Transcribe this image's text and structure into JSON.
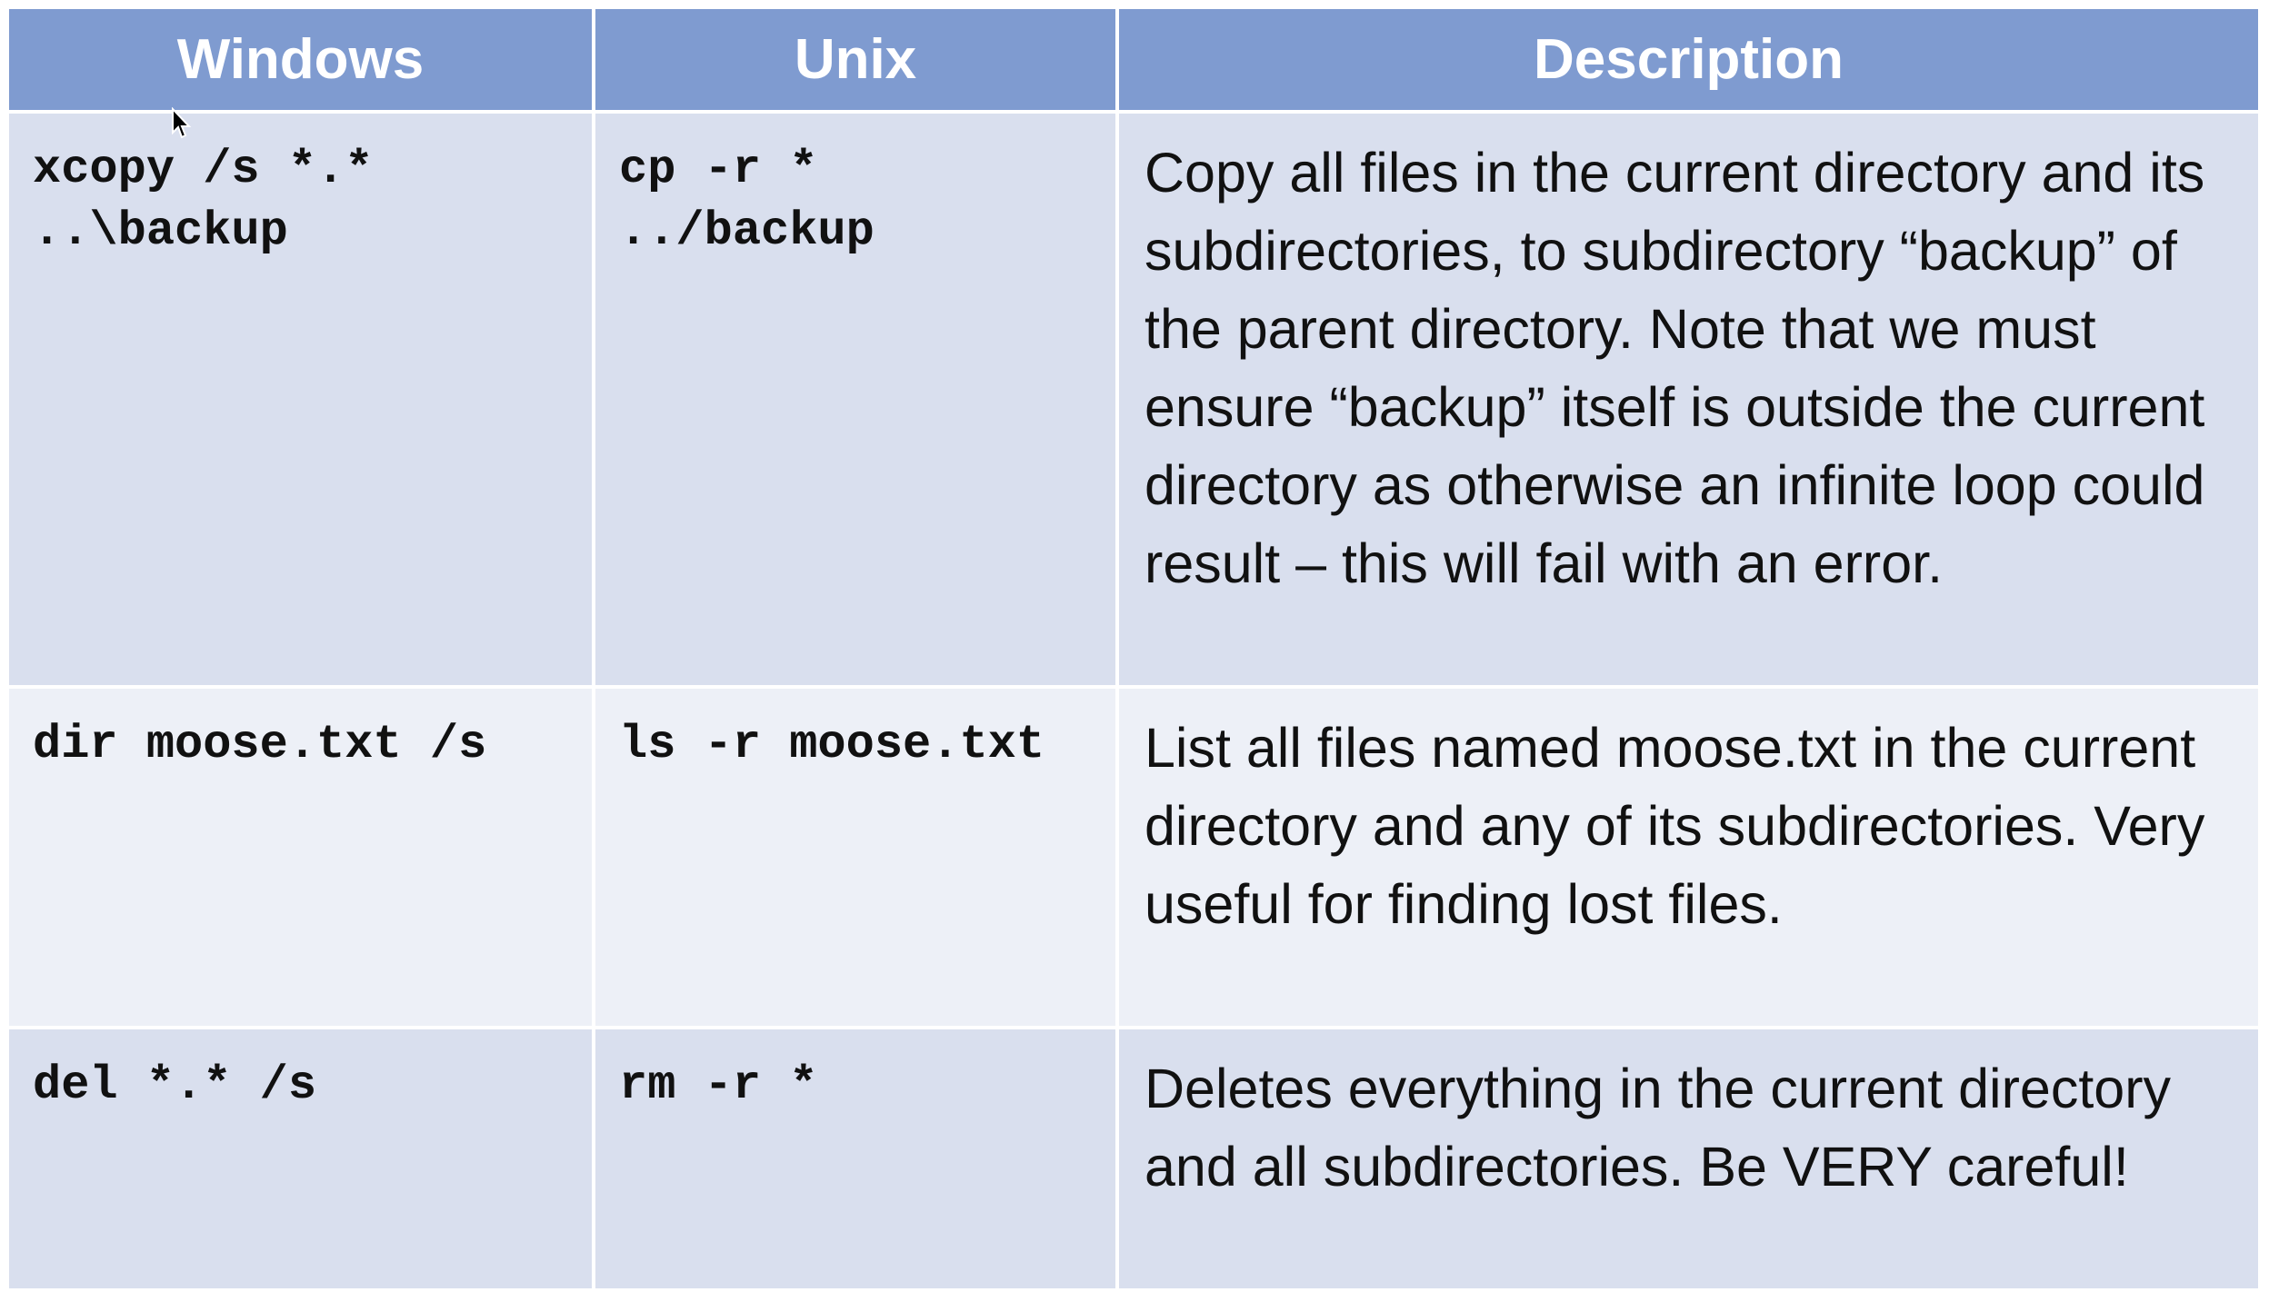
{
  "table": {
    "headers": {
      "windows": "Windows",
      "unix": "Unix",
      "description": "Description"
    },
    "rows": [
      {
        "windows": "xcopy /s *.*\n..\\backup",
        "unix": "cp -r *\n../backup",
        "description": "Copy all files in the current directory and its subdirectories, to subdirectory “backup” of the parent directory. Note that we must ensure “backup” itself is outside the current directory as otherwise an infinite loop could result – this will fail with an error."
      },
      {
        "windows": "dir moose.txt /s",
        "unix": "ls -r moose.txt",
        "description": "List all files named moose.txt in the current directory and any of its subdirectories. Very useful for finding lost files."
      },
      {
        "windows": "del *.* /s",
        "unix": "rm -r *",
        "description": "Deletes everything in the current directory and all subdirectories. Be VERY careful!"
      }
    ]
  },
  "colors": {
    "header_bg": "#7f9bd0",
    "row_odd_bg": "#d9dfee",
    "row_even_bg": "#edf0f7",
    "header_text": "#ffffff",
    "body_text": "#111111"
  },
  "icons": {
    "cursor": "mouse-pointer-icon"
  }
}
